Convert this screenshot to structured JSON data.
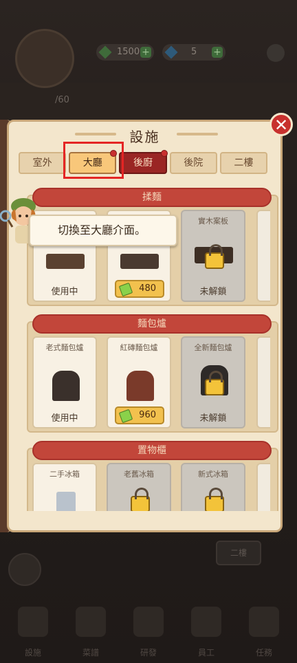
{
  "hud": {
    "currency1_value": "1500",
    "currency2_value": "5",
    "level_value": "60",
    "green_color": "#4fa74a",
    "blue_color": "#2e9be0"
  },
  "panel": {
    "title": "設施",
    "tabs": [
      {
        "label": "室外",
        "state": "normal"
      },
      {
        "label": "大廳",
        "state": "active"
      },
      {
        "label": "後廚",
        "state": "hot"
      },
      {
        "label": "後院",
        "state": "normal"
      },
      {
        "label": "二樓",
        "state": "normal"
      }
    ],
    "sections": [
      {
        "title": "揉麵",
        "cards": [
          {
            "name": "",
            "status": "使用中",
            "price": "",
            "locked": false
          },
          {
            "name": "",
            "status": "",
            "price": "480",
            "locked": false
          },
          {
            "name": "實木案板",
            "status": "未解鎖",
            "price": "",
            "locked": true
          }
        ]
      },
      {
        "title": "麵包爐",
        "cards": [
          {
            "name": "老式麵包爐",
            "status": "使用中",
            "price": "",
            "locked": false
          },
          {
            "name": "紅磚麵包爐",
            "status": "",
            "price": "960",
            "locked": false
          },
          {
            "name": "全新麵包爐",
            "status": "未解鎖",
            "price": "",
            "locked": true
          }
        ]
      },
      {
        "title": "置物櫃",
        "cards": [
          {
            "name": "二手冰箱",
            "status": "",
            "price": "",
            "locked": false
          },
          {
            "name": "老舊冰箱",
            "status": "",
            "price": "",
            "locked": true
          },
          {
            "name": "新式冰箱",
            "status": "",
            "price": "",
            "locked": true
          }
        ]
      }
    ]
  },
  "tutorial": {
    "text": "切換至大廳介面。"
  },
  "background": {
    "floor_sign": "二樓",
    "bottom_nav": [
      "設施",
      "菜譜",
      "研發",
      "員工",
      "任務"
    ]
  },
  "colors": {
    "highlight": "#e42524",
    "close_button": "#c8312e",
    "section_header": "#c2463a",
    "active_tab": "#f8c77a"
  }
}
